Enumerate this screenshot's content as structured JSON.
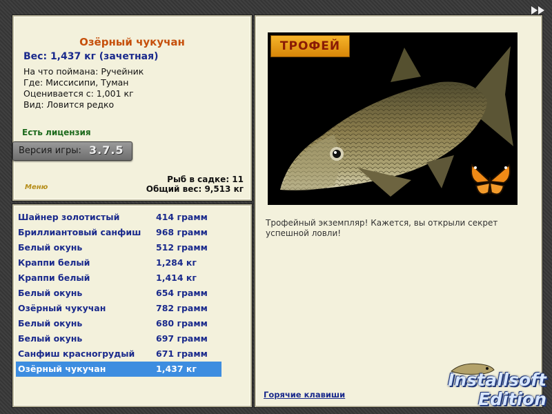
{
  "fish": {
    "name": "Озёрный чукучан",
    "weight_text": "Вес: 1,437 кг (зачетная)",
    "details": [
      "На что поймана: Ручейник",
      "Где: Миссисипи, Туман",
      "Оценивается с: 1,001 кг",
      "Вид: Ловится редко"
    ],
    "license": "Есть лицензия"
  },
  "version": {
    "label": "Версия игры:",
    "value": "3.7.5"
  },
  "menu_label": "Меню",
  "summary": {
    "count_text": "Рыб в садке: 11",
    "total_text": "Общий вес: 9,513 кг"
  },
  "catch_list": [
    {
      "name": "Шайнер золотистый",
      "weight": "414 грамм"
    },
    {
      "name": "Бриллиантовый санфиш",
      "weight": "968 грамм"
    },
    {
      "name": "Белый окунь",
      "weight": "512 грамм"
    },
    {
      "name": "Краппи белый",
      "weight": "1,284 кг"
    },
    {
      "name": "Краппи белый",
      "weight": "1,414 кг"
    },
    {
      "name": "Белый окунь",
      "weight": "654 грамм"
    },
    {
      "name": "Озёрный чукучан",
      "weight": "782 грамм"
    },
    {
      "name": "Белый окунь",
      "weight": "680 грамм"
    },
    {
      "name": "Белый окунь",
      "weight": "697 грамм"
    },
    {
      "name": "Санфиш красногрудый",
      "weight": "671 грамм"
    },
    {
      "name": "Озёрный чукучан",
      "weight": "1,437 кг"
    }
  ],
  "selected_index": 10,
  "trophy_label": "ТРОФЕЙ",
  "description": "Трофейный экземпляр! Кажется, вы открыли секрет успешной ловли!",
  "hotkeys_label": "Горячие клавиши",
  "logo": {
    "line1": "Installsoft",
    "line2": "Edition"
  },
  "icons": {
    "top_right": "fast-forward-icon",
    "photo": "fish-photo",
    "butterfly": "butterfly-icon"
  },
  "colors": {
    "panel_bg": "#f3f1dc",
    "title": "#c6500c",
    "list_text": "#1a2a8c",
    "selected": "#3d8de0"
  }
}
